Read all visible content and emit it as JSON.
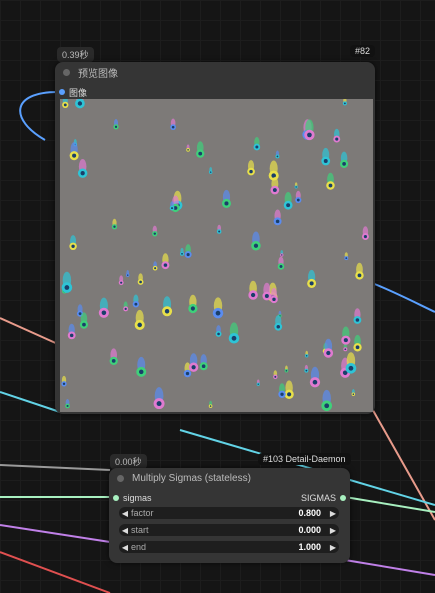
{
  "preview_node": {
    "time_badge": "0.39秒",
    "id_badge": "#82",
    "title": "预览图像",
    "input_label": "图像"
  },
  "sigmas_node": {
    "time_badge": "0.00秒",
    "id_badge": "#103 Detail-Daemon",
    "title": "Multiply Sigmas (stateless)",
    "input_label": "sigmas",
    "output_label": "SIGMAS",
    "widgets": [
      {
        "label": "factor",
        "value": "0.800"
      },
      {
        "label": "start",
        "value": "0.000"
      },
      {
        "label": "end",
        "value": "1.000"
      }
    ]
  },
  "colors": {
    "wire_blue": "#5aa0ff",
    "wire_cyan": "#62d3e6",
    "wire_salmon": "#e89b8b",
    "wire_mint": "#a8f0c0",
    "wire_purple": "#c080e8",
    "wire_red": "#e05050",
    "wire_gray": "#9a9a9a"
  }
}
